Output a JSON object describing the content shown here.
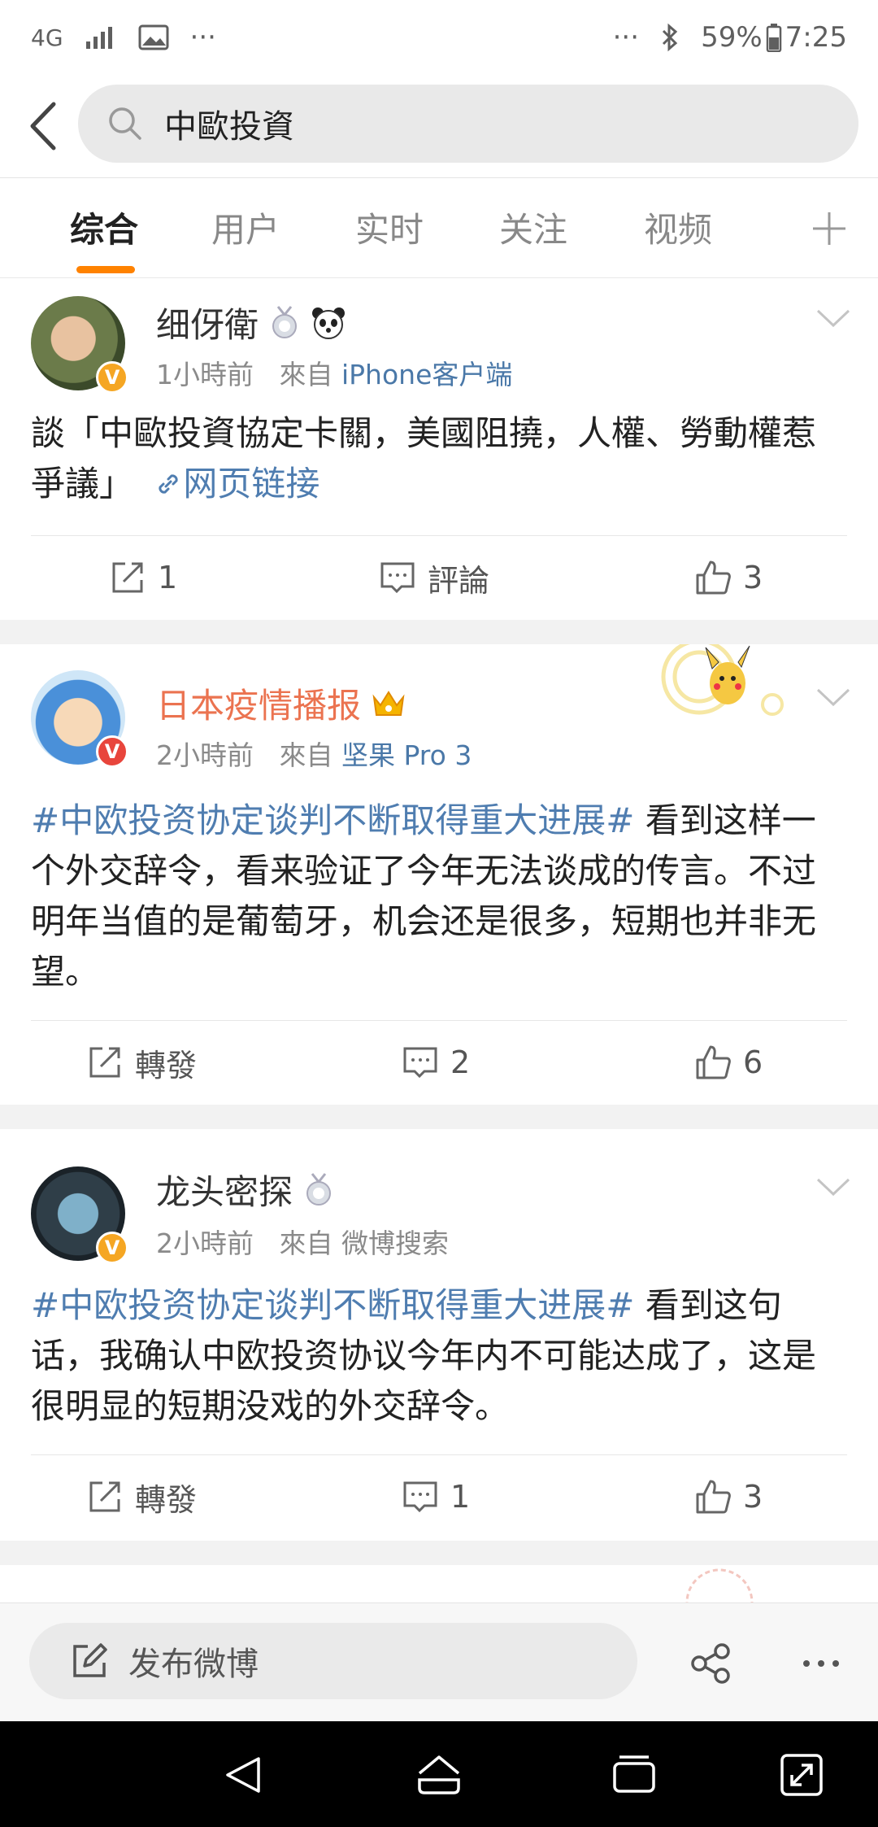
{
  "status_bar": {
    "network": "4G",
    "battery": "59%",
    "time": "7:25",
    "left_more": "···",
    "right_more": "···"
  },
  "search": {
    "query": "中歐投資"
  },
  "tabs": [
    {
      "label": "综合"
    },
    {
      "label": "用户"
    },
    {
      "label": "实时"
    },
    {
      "label": "关注"
    },
    {
      "label": "视频"
    }
  ],
  "posts": [
    {
      "username": "细伢衛",
      "time": "1小時前",
      "from": "來自",
      "source": "iPhone客户端",
      "text": "談「中歐投資協定卡關，美國阻撓，人權、勞動權惹爭議」",
      "link_label": "网页链接",
      "repost": "1",
      "comment": "評論",
      "like": "3"
    },
    {
      "username": "日本疫情播报",
      "time": "2小時前",
      "from": "來自",
      "source": "坚果 Pro 3",
      "topic": "#中欧投资协定谈判不断取得重大进展#",
      "text": " 看到这样一个外交辞令，看来验证了今年无法谈成的传言。不过明年当值的是葡萄牙，机会还是很多，短期也并非无望。",
      "repost": "轉發",
      "comment": "2",
      "like": "6"
    },
    {
      "username": "龙头密探",
      "time": "2小時前",
      "from": "來自",
      "source": "微博搜索",
      "topic": "#中欧投资协定谈判不断取得重大进展#",
      "text": " 看到这句话，我确认中欧投资协议今年内不可能达成了，这是很明显的短期没戏的外交辞令。",
      "repost": "轉發",
      "comment": "1",
      "like": "3"
    }
  ],
  "compose": {
    "label": "发布微博"
  },
  "colors": {
    "accent": "#ff8200",
    "link": "#4f7db0",
    "vip_name": "#eb7350"
  }
}
